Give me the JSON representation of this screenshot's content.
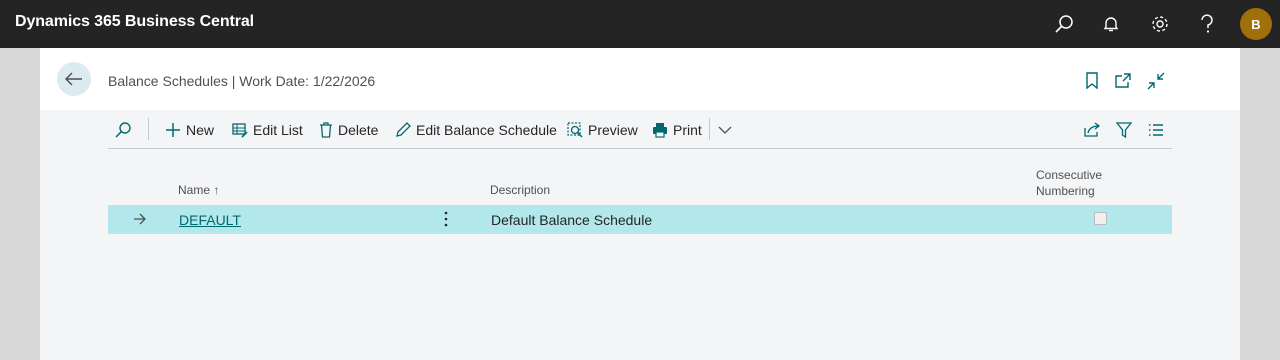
{
  "app": {
    "title": "Dynamics 365 Business Central",
    "user_initial": "B",
    "icons": [
      "search-icon",
      "bell-icon",
      "gear-icon",
      "help-icon"
    ]
  },
  "page": {
    "title": "Balance Schedules | Work Date: 1/22/2026"
  },
  "actions": {
    "new": "New",
    "edit_list": "Edit List",
    "delete": "Delete",
    "edit_balance_schedule": "Edit Balance Schedule",
    "preview": "Preview",
    "print": "Print"
  },
  "list": {
    "columns": {
      "name": "Name",
      "sort_indicator": "↑",
      "description": "Description",
      "consecutive_line1": "Consecutive",
      "consecutive_line2": "Numbering"
    },
    "rows": [
      {
        "name": "DEFAULT",
        "description": "Default Balance Schedule",
        "consecutive_numbering": false
      }
    ]
  },
  "colors": {
    "app_bar": "#242424",
    "accent": "#00696e",
    "selected_row": "#b2e7eb",
    "avatar": "#a0700a"
  }
}
